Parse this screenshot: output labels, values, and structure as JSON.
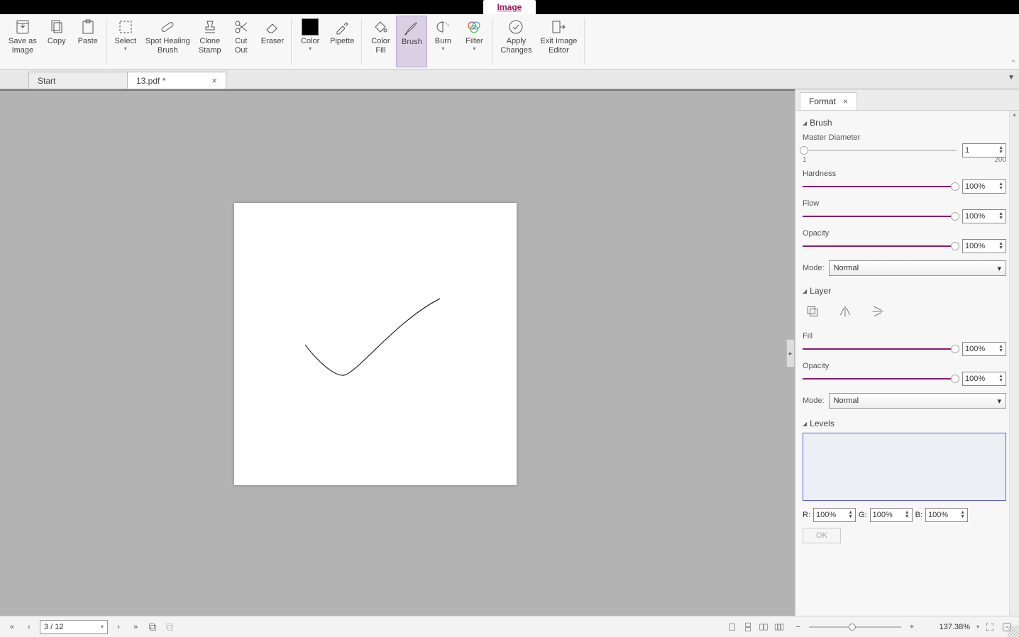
{
  "topTab": {
    "label": "Image"
  },
  "ribbon": {
    "save_as_image": "Save as\nImage",
    "copy": "Copy",
    "paste": "Paste",
    "select": "Select",
    "spot_healing": "Spot Healing\nBrush",
    "clone_stamp": "Clone\nStamp",
    "cut_out": "Cut\nOut",
    "eraser": "Eraser",
    "color": "Color",
    "pipette": "Pipette",
    "color_fill": "Color\nFill",
    "brush": "Brush",
    "burn": "Burn",
    "filter": "Filter",
    "apply_changes": "Apply\nChanges",
    "exit": "Exit Image\nEditor"
  },
  "docTabs": {
    "start": "Start",
    "file": "13.pdf *"
  },
  "panel": {
    "tab": "Format",
    "brush_section": "Brush",
    "master_diameter": {
      "label": "Master Diameter",
      "value": "1",
      "min": "1",
      "max": "200"
    },
    "hardness": {
      "label": "Hardness",
      "value": "100%"
    },
    "flow": {
      "label": "Flow",
      "value": "100%"
    },
    "opacity": {
      "label": "Opacity",
      "value": "100%"
    },
    "mode_label": "Mode:",
    "mode_value": "Normal",
    "layer_section": "Layer",
    "layer_fill": {
      "label": "Fill",
      "value": "100%"
    },
    "layer_opacity": {
      "label": "Opacity",
      "value": "100%"
    },
    "layer_mode_value": "Normal",
    "levels_section": "Levels",
    "r_label": "R:",
    "g_label": "G:",
    "b_label": "B:",
    "r_value": "100%",
    "g_value": "100%",
    "b_value": "100%",
    "ok": "OK"
  },
  "bottom": {
    "page": "3 / 12",
    "zoom": "137.38%"
  }
}
